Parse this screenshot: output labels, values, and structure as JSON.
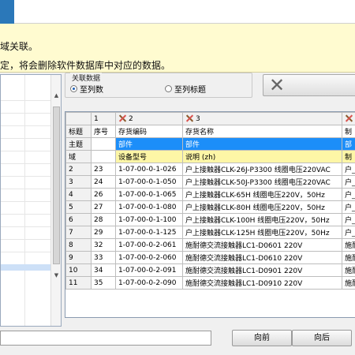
{
  "info": {
    "line1": "域关联。",
    "line2": "定，将会删除软件数据库中对应的数据。"
  },
  "association": {
    "legend": "关联数据",
    "option1": "至列数",
    "option2": "至列标题"
  },
  "grid": {
    "header": [
      "",
      "1",
      "2",
      "3",
      ""
    ],
    "label_rows": [
      [
        "标题",
        "序号",
        "存货编码",
        "存货名称",
        "制"
      ],
      [
        "主题",
        "",
        "部件",
        "部件",
        "部"
      ],
      [
        "域",
        "",
        "设备型号",
        "说明 (zh)",
        "制"
      ]
    ],
    "rows": [
      [
        "2",
        "23",
        "1-07-00-0-1-026",
        "户上接触器CLK-26J-P3300  线圈电压220VAC",
        "户_"
      ],
      [
        "3",
        "24",
        "1-07-00-0-1-050",
        "户上接触器CLK-50J-P3300  线圈电压220VAC",
        "户_"
      ],
      [
        "4",
        "26",
        "1-07-00-0-1-065",
        "户上接触器CLK-65H    线圈电压220V，50Hz",
        "户_"
      ],
      [
        "5",
        "27",
        "1-07-00-0-1-080",
        "户上接触器CLK-80H    线圈电压220V，50Hz",
        "户_"
      ],
      [
        "6",
        "28",
        "1-07-00-0-1-100",
        "户上接触器CLK-100H    线圈电压220V，50Hz",
        "户_"
      ],
      [
        "7",
        "29",
        "1-07-00-0-1-125",
        "户上接触器CLK-125H    线圈电压220V，50Hz",
        "户_"
      ],
      [
        "8",
        "32",
        "1-07-00-0-2-061",
        "施耐德交流接触器LC1-D0601 220V",
        "施耐"
      ],
      [
        "9",
        "33",
        "1-07-00-0-2-060",
        "施耐德交流接触器LC1-D0610 220V",
        "施耐"
      ],
      [
        "10",
        "34",
        "1-07-00-0-2-091",
        "施耐德交流接触器LC1-D0901 220V",
        "施耐"
      ],
      [
        "11",
        "35",
        "1-07-00-0-2-090",
        "施耐德交流接触器LC1-D0910 220V",
        "施耐"
      ]
    ]
  },
  "buttons": {
    "prev": "向前",
    "next": "向后"
  },
  "colors": {
    "info_bg": "#fffbd0",
    "blue_cell": "#1c8ef9",
    "yellow_cell": "#fdf6a6"
  }
}
